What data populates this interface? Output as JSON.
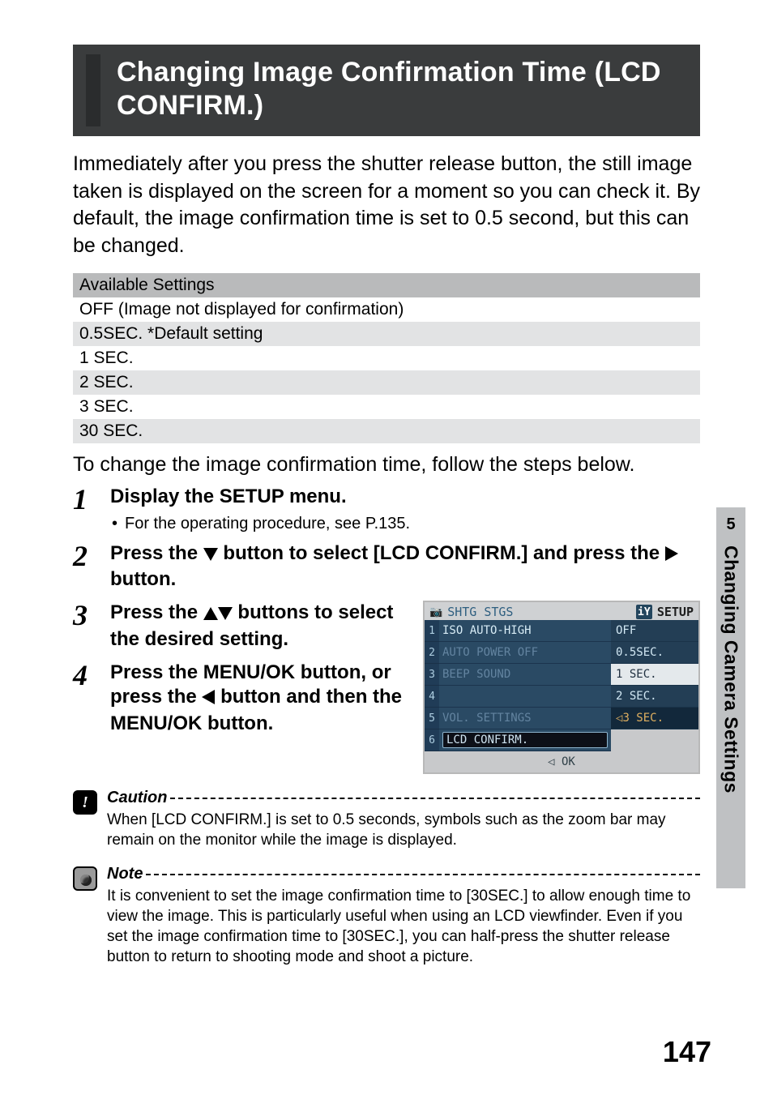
{
  "title": "Changing Image Confirmation Time (LCD CONFIRM.)",
  "intro": "Immediately after you press the shutter release button, the still image taken is displayed on the screen for a moment so you can check it. By default, the image confirmation time is set to 0.5 second, but this can be changed.",
  "settings_header": "Available Settings",
  "settings": [
    "OFF (Image not displayed for confirmation)",
    "0.5SEC. *Default setting",
    "1 SEC.",
    "2 SEC.",
    "3 SEC.",
    "30 SEC."
  ],
  "follow": "To change the image confirmation time, follow the steps below.",
  "steps": {
    "s1_title": "Display the SETUP menu.",
    "s1_sub": "For the operating procedure, see P.135.",
    "s2_a": "Press the ",
    "s2_b": " button to select [LCD CONFIRM.] and press the ",
    "s2_c": " button.",
    "s3_a": "Press the ",
    "s3_b": " buttons to select the desired setting.",
    "s4_a": "Press the MENU/OK button, or press the ",
    "s4_b": " button and then the MENU/OK button."
  },
  "lcd": {
    "tab1": "SHTG STGS",
    "tab2": "SETUP",
    "rows": [
      {
        "n": "1",
        "label": "ISO AUTO-HIGH"
      },
      {
        "n": "2",
        "label": "AUTO POWER OFF"
      },
      {
        "n": "3",
        "label": "BEEP SOUND"
      },
      {
        "n": "4",
        "label": ""
      },
      {
        "n": "5",
        "label": "VOL. SETTINGS"
      },
      {
        "n": "6",
        "label": "LCD CONFIRM."
      }
    ],
    "vals": [
      "OFF",
      "0.5SEC.",
      "1 SEC.",
      "2 SEC.",
      "3 SEC."
    ],
    "val_sel_index": 4,
    "ok": "◁ OK"
  },
  "caution_label": "Caution",
  "caution_text": "When [LCD CONFIRM.] is set to 0.5 seconds, symbols such as the zoom bar may remain on the monitor while the image is displayed.",
  "note_label": "Note",
  "note_text": "It is convenient to set the image confirmation time to [30SEC.] to allow enough time to view the image. This is particularly useful when using an LCD viewfinder. Even if you set the image confirmation time to [30SEC.], you can half-press the shutter release button to return to shooting mode and shoot a picture.",
  "side": {
    "chapter": "5",
    "label": "Changing Camera Settings"
  },
  "page_number": "147"
}
